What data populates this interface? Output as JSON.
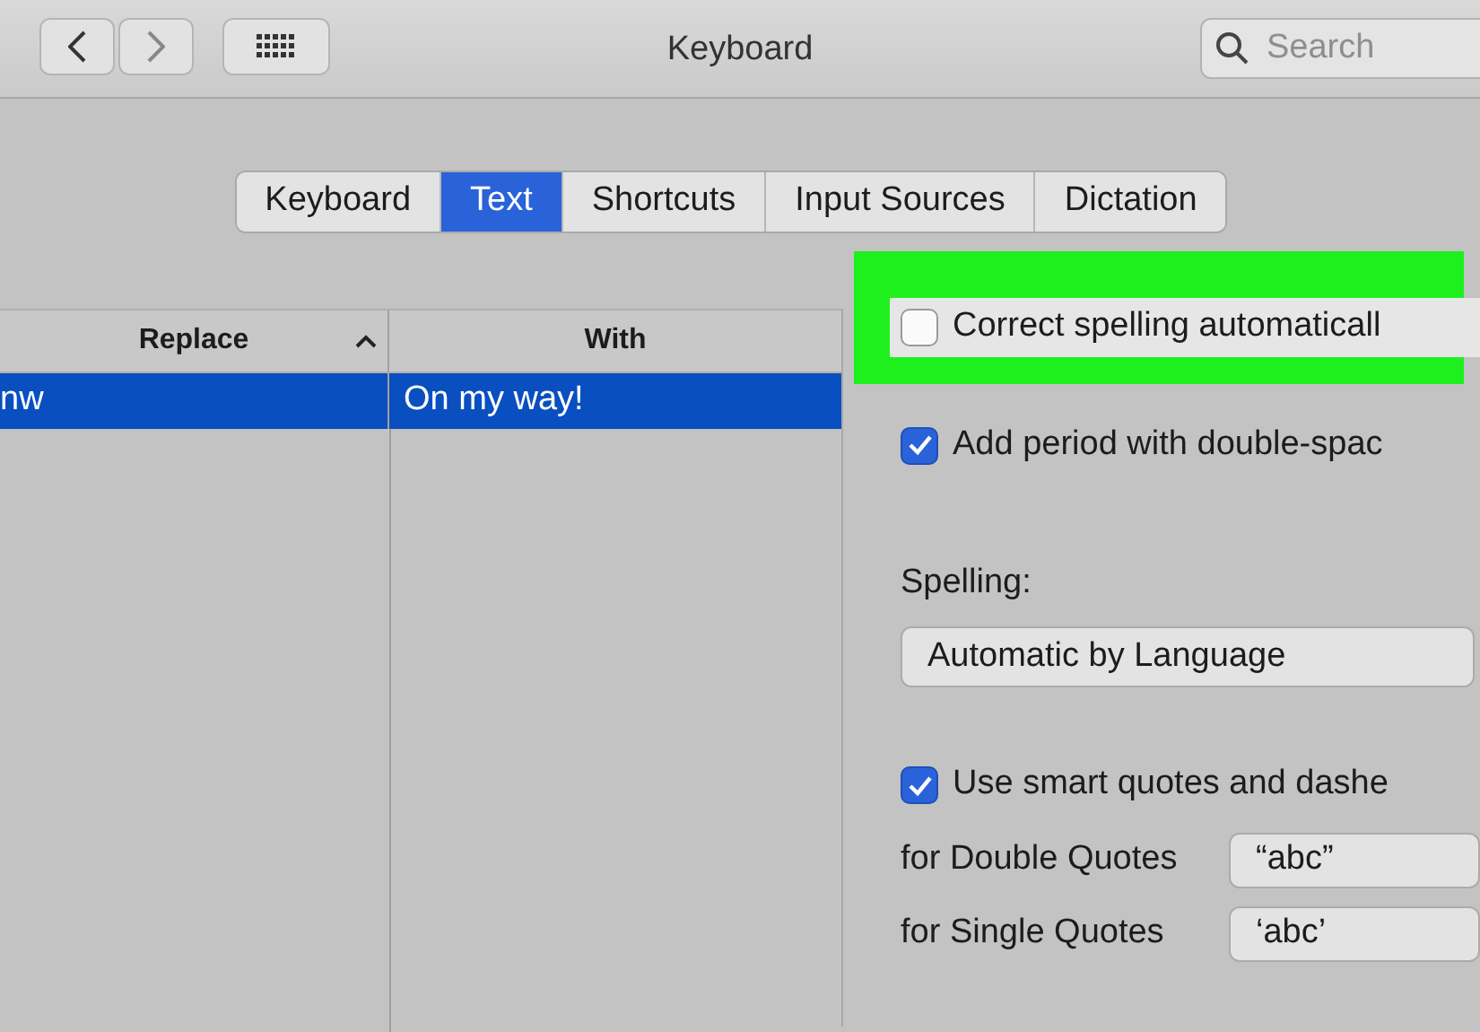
{
  "window": {
    "title": "Keyboard"
  },
  "toolbar": {
    "search": {
      "placeholder": "Search"
    }
  },
  "tabs": [
    {
      "label": "Keyboard",
      "selected": false
    },
    {
      "label": "Text",
      "selected": true
    },
    {
      "label": "Shortcuts",
      "selected": false
    },
    {
      "label": "Input Sources",
      "selected": false
    },
    {
      "label": "Dictation",
      "selected": false
    }
  ],
  "table": {
    "columns": [
      {
        "label": "Replace",
        "sorted": true
      },
      {
        "label": "With",
        "sorted": false
      }
    ],
    "rows": [
      {
        "cells": [
          "nw",
          "On my way!"
        ],
        "selected": true
      }
    ]
  },
  "options": [
    {
      "label": "Correct spelling automaticall",
      "checked": false,
      "highlighted": true
    },
    {
      "label": "Add period with double-spac",
      "checked": true,
      "highlighted": false
    }
  ],
  "spelling": {
    "label": "Spelling:",
    "value": "Automatic by Language"
  },
  "smart_quotes": {
    "label": "Use smart quotes and dashe",
    "checked": true,
    "fields": [
      {
        "label": "for Double Quotes",
        "value": "“abc”"
      },
      {
        "label": "for Single Quotes",
        "value": "‘abc’"
      }
    ]
  }
}
